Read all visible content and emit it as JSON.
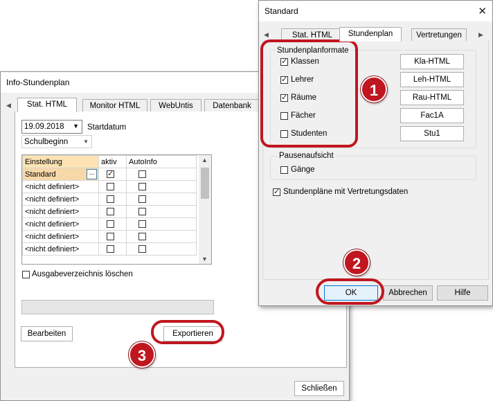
{
  "info_window": {
    "title": "Info-Stundenplan",
    "tabs": [
      "Stat. HTML",
      "Monitor HTML",
      "WebUntis",
      "Datenbank"
    ],
    "date_value": "19.09.2018",
    "date_label": "Startdatum",
    "mode_value": "Schulbeginn",
    "table": {
      "headers": [
        "Einstellung",
        "aktiv",
        "AutoInfo"
      ],
      "rows": [
        {
          "name": "Standard",
          "aktiv": true,
          "autoinfo": false,
          "ellipsis": "..."
        },
        {
          "name": "<nicht definiert>",
          "aktiv": false,
          "autoinfo": false
        },
        {
          "name": "<nicht definiert>",
          "aktiv": false,
          "autoinfo": false
        },
        {
          "name": "<nicht definiert>",
          "aktiv": false,
          "autoinfo": false
        },
        {
          "name": "<nicht definiert>",
          "aktiv": false,
          "autoinfo": false
        },
        {
          "name": "<nicht definiert>",
          "aktiv": false,
          "autoinfo": false
        },
        {
          "name": "<nicht definiert>",
          "aktiv": false,
          "autoinfo": false
        }
      ]
    },
    "clear_output_label": "Ausgabeverzeichnis löschen",
    "edit_button": "Bearbeiten",
    "export_button": "Exportieren",
    "close_button": "Schließen"
  },
  "standard_window": {
    "title": "Standard",
    "tabs": [
      "Stat. HTML",
      "Stundenplan",
      "Vertretungen"
    ],
    "formats_group": "Stundenplanformate",
    "formats": [
      {
        "label": "Klassen",
        "checked": true,
        "value": "Kla-HTML"
      },
      {
        "label": "Lehrer",
        "checked": true,
        "value": "Leh-HTML"
      },
      {
        "label": "Räume",
        "checked": true,
        "value": "Rau-HTML"
      },
      {
        "label": "Fächer",
        "checked": false,
        "value": "Fac1A"
      },
      {
        "label": "Studenten",
        "checked": false,
        "value": "Stu1"
      }
    ],
    "breaks_group": "Pausenaufsicht",
    "breaks_item": {
      "label": "Gänge",
      "checked": false
    },
    "with_substitutions": {
      "label": "Stundenpläne mit Vertretungsdaten",
      "checked": true
    },
    "ok_button": "OK",
    "cancel_button": "Abbrechen",
    "help_button": "Hilfe"
  },
  "callouts": [
    "1",
    "2",
    "3"
  ],
  "colors": {
    "callout_red": "#c0161f",
    "header_row": "#fde3b4",
    "selected_row": "#f7d8a8"
  }
}
